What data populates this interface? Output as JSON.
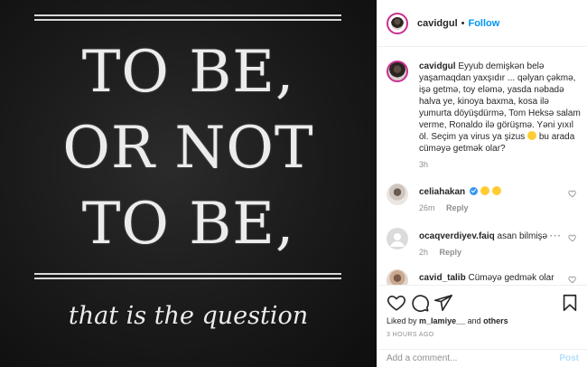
{
  "image": {
    "lines": [
      "TO BE,",
      "OR NOT",
      "TO BE,"
    ],
    "subline": "that is the question"
  },
  "header": {
    "username": "cavidgul",
    "separator": "•",
    "follow_label": "Follow"
  },
  "caption": {
    "username": "cavidgul",
    "text": "Eyyub demişkən belə yaşamaqdan yaxşıdır ... qəlyan çəkmə, işə getmə, toy eləmə, yasda nəbadə halva ye, kinoya baxma, kosa ilə yumurta döyüşdürmə, Tom Heksə salam verme, Ronaldo ilə görüşmə. Yəni yıxıl öl. Seçim ya virus ya şizus",
    "text_after_emoji": "bu arada cüməyə getmək olar?",
    "time": "3h"
  },
  "comments": [
    {
      "username": "celiahakan",
      "text": "",
      "time": "26m",
      "reply_label": "Reply"
    },
    {
      "username": "ocaqverdiyev.faiq",
      "text": "asan bilmişə",
      "time": "2h",
      "reply_label": "Reply"
    },
    {
      "username": "cavid_talib",
      "text": "Cüməyə gedmək olar",
      "time": "",
      "reply_label": ""
    }
  ],
  "actions": {
    "likes_prefix": "Liked by",
    "liked_user": "m_lamiye__",
    "likes_and": "and",
    "likes_others": "others",
    "time_ago": "3 HOURS AGO"
  },
  "add_comment": {
    "placeholder": "Add a comment...",
    "post_label": "Post"
  },
  "colors": {
    "accent": "#0095f6",
    "story_ring": "#c8308e",
    "post_disabled": "#b2dffc"
  }
}
